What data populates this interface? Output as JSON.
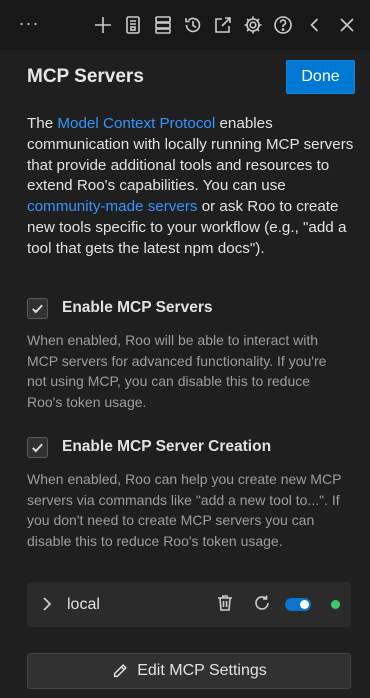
{
  "toolbar": {
    "more_label": "···",
    "icons": [
      "more-icon",
      "plus-icon",
      "history-notebook-icon",
      "server-icon",
      "history-icon",
      "popout-icon",
      "gear-icon",
      "help-icon",
      "chevron-left-icon",
      "close-icon"
    ]
  },
  "header": {
    "title": "MCP Servers",
    "done_label": "Done"
  },
  "intro": {
    "part1": "The ",
    "link1": "Model Context Protocol",
    "part2": " enables communication with locally running MCP servers that provide additional tools and resources to extend Roo's capabilities. You can use ",
    "link2": "community-made servers",
    "part3": " or ask Roo to create new tools specific to your workflow (e.g., \"add a tool that gets the latest npm docs\")."
  },
  "options": [
    {
      "label": "Enable MCP Servers",
      "checked": true,
      "description": "When enabled, Roo will be able to interact with MCP servers for advanced functionality. If you're not using MCP, you can disable this to reduce Roo's token usage."
    },
    {
      "label": "Enable MCP Server Creation",
      "checked": true,
      "description": "When enabled, Roo can help you create new MCP servers via commands like \"add a new tool to...\". If you don't need to create MCP servers you can disable this to reduce Roo's token usage."
    }
  ],
  "servers": [
    {
      "name": "local",
      "enabled": true,
      "status_color": "#3dc96b"
    }
  ],
  "edit_button_label": "Edit MCP Settings",
  "colors": {
    "accent": "#0078d4",
    "link": "#3794ff",
    "status_ok": "#3dc96b"
  }
}
